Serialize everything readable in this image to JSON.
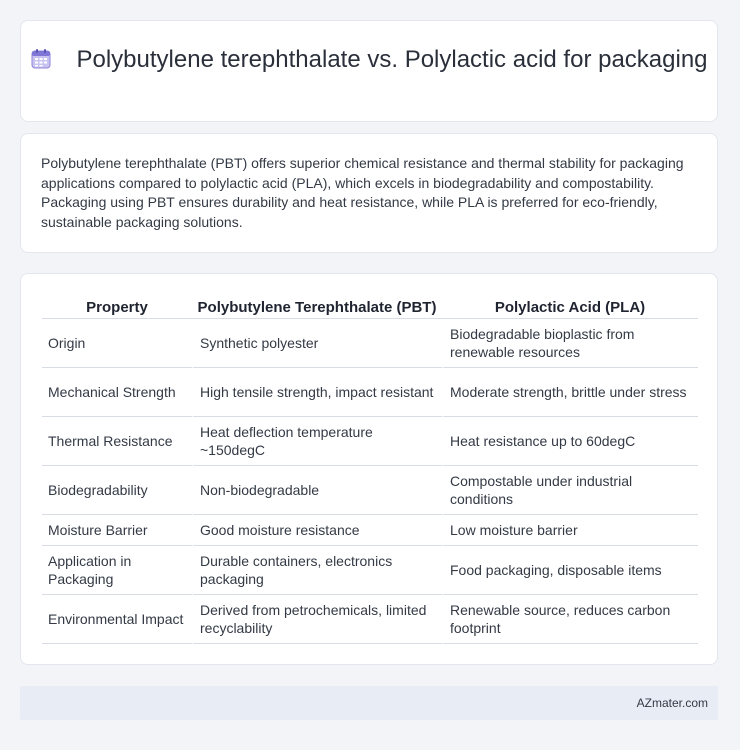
{
  "header": {
    "icon": "calendar-icon",
    "title": "Polybutylene terephthalate vs. Polylactic acid for packaging"
  },
  "summary": "Polybutylene terephthalate (PBT) offers superior chemical resistance and thermal stability for packaging applications compared to polylactic acid (PLA), which excels in biodegradability and compostability. Packaging using PBT ensures durability and heat resistance, while PLA is preferred for eco-friendly, sustainable packaging solutions.",
  "table": {
    "headers": [
      "Property",
      "Polybutylene Terephthalate (PBT)",
      "Polylactic Acid (PLA)"
    ],
    "rows": [
      [
        "Origin",
        "Synthetic polyester",
        "Biodegradable bioplastic from renewable resources"
      ],
      [
        "Mechanical Strength",
        "High tensile strength, impact resistant",
        "Moderate strength, brittle under stress"
      ],
      [
        "Thermal Resistance",
        "Heat deflection temperature ~150degC",
        "Heat resistance up to 60degC"
      ],
      [
        "Biodegradability",
        "Non-biodegradable",
        "Compostable under industrial conditions"
      ],
      [
        "Moisture Barrier",
        "Good moisture resistance",
        "Low moisture barrier"
      ],
      [
        "Application in Packaging",
        "Durable containers, electronics packaging",
        "Food packaging, disposable items"
      ],
      [
        "Environmental Impact",
        "Derived from petrochemicals, limited recyclability",
        "Renewable source, reduces carbon footprint"
      ]
    ]
  },
  "footer": {
    "brand": "AZmater.com"
  }
}
